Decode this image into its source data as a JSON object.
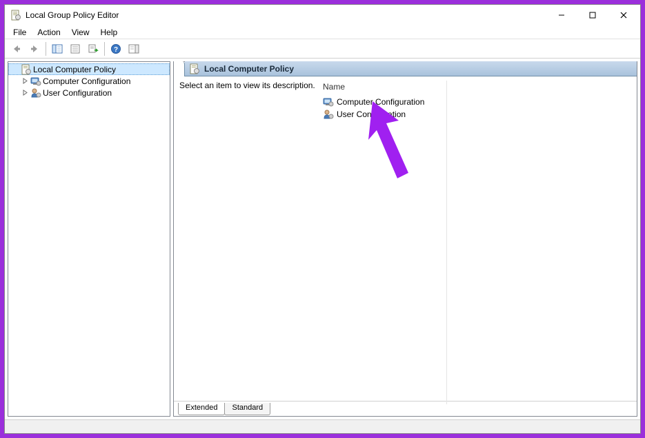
{
  "window": {
    "title": "Local Group Policy Editor"
  },
  "menubar": {
    "items": [
      "File",
      "Action",
      "View",
      "Help"
    ]
  },
  "toolbar": {
    "buttons": [
      "back",
      "forward",
      "sep",
      "show-hide-tree",
      "properties",
      "export-list",
      "sep",
      "help",
      "show-hide-action-pane"
    ]
  },
  "tree": {
    "root": {
      "label": "Local Computer Policy",
      "selected": true,
      "children": [
        {
          "label": "Computer Configuration",
          "icon": "computer"
        },
        {
          "label": "User Configuration",
          "icon": "user"
        }
      ]
    }
  },
  "detail": {
    "header": "Local Computer Policy",
    "description_prompt": "Select an item to view its description.",
    "column_header": "Name",
    "items": [
      {
        "label": "Computer Configuration",
        "icon": "computer"
      },
      {
        "label": "User Configuration",
        "icon": "user"
      }
    ]
  },
  "tabs": {
    "items": [
      "Extended",
      "Standard"
    ],
    "active_index": 0
  }
}
